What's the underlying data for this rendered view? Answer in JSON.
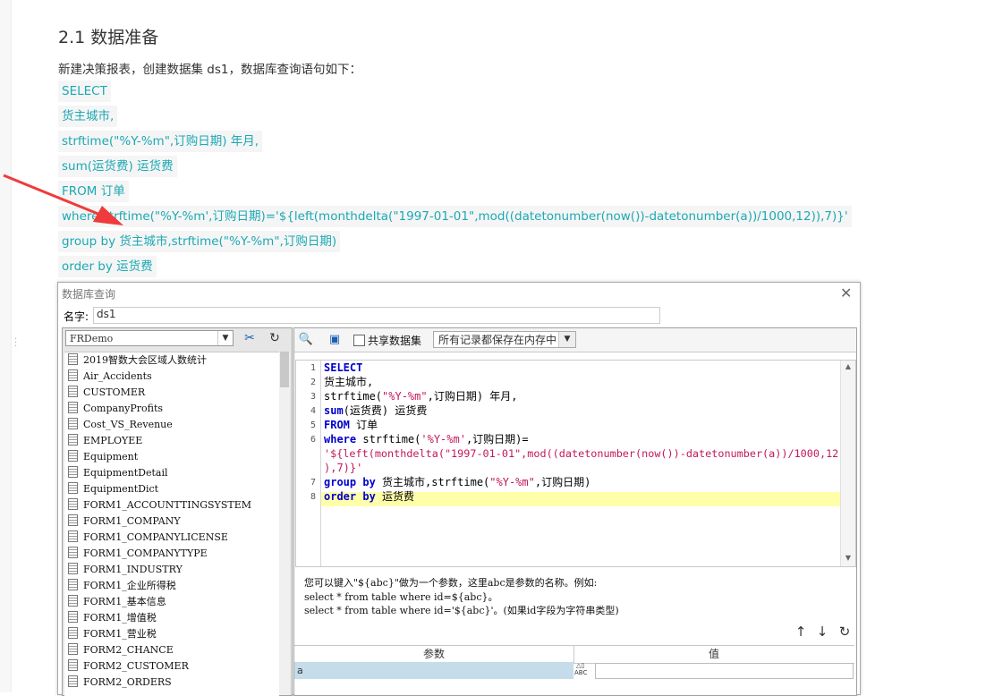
{
  "article": {
    "title": "2.1 数据准备",
    "desc": "新建决策报表，创建数据集 ds1，数据库查询语句如下：",
    "code_lines": [
      "SELECT",
      "货主城市,",
      "strftime(\"%Y-%m\",订购日期) 年月,",
      "sum(运货费) 运货费",
      "FROM 订单",
      "where strftime(\"%Y-%m',订购日期)='${left(monthdelta(\"1997-01-01\",mod((datetonumber(now())-datetonumber(a))/1000,12)),7)}'",
      "group by 货主城市,strftime(\"%Y-%m\",订购日期)",
      "order by 运货费"
    ]
  },
  "dialog": {
    "title": "数据库查询",
    "name_label": "名字:",
    "name_value": "ds1",
    "datasource": "FRDemo",
    "share_label": "共享数据集",
    "cache_option": "所有记录都保存在内存中",
    "tables": [
      "2019智数大会区域人数统计",
      "Air_Accidents",
      "CUSTOMER",
      "CompanyProfits",
      "Cost_VS_Revenue",
      "EMPLOYEE",
      "Equipment",
      "EquipmentDetail",
      "EquipmentDict",
      "FORM1_ACCOUNTTINGSYSTEM",
      "FORM1_COMPANY",
      "FORM1_COMPANYLICENSE",
      "FORM1_COMPANYTYPE",
      "FORM1_INDUSTRY",
      "FORM1_企业所得税",
      "FORM1_基本信息",
      "FORM1_增值税",
      "FORM1_营业税",
      "FORM2_CHANCE",
      "FORM2_CUSTOMER",
      "FORM2_ORDERS"
    ],
    "sql": {
      "line_numbers": [
        "1",
        "2",
        "3",
        "4",
        "5",
        "6",
        "7",
        "8"
      ],
      "l1_kw": "SELECT",
      "l2": "货主城市,",
      "l3_a": "strftime(",
      "l3_str": "\"%Y-%m\"",
      "l3_b": ",订购日期) 年月,",
      "l4_kw": "sum",
      "l4_b": "(运货费) 运货费",
      "l5_kw": "FROM",
      "l5_b": " 订单",
      "l6_kw": "where",
      "l6_a": " strftime(",
      "l6_str": "'%Y-%m'",
      "l6_b": ",订购日期)=",
      "l6_wrap1": "'${left(monthdelta(\"1997-01-01\",mod((datetonumber(now())-datetonumber(a))/1000,12)",
      "l6_wrap2": "),7)}'",
      "l7_kw": "group by",
      "l7_a": " 货主城市,strftime(",
      "l7_str": "\"%Y-%m\"",
      "l7_b": ",订购日期)",
      "l8_kw": "order by",
      "l8_b": " 运货费"
    },
    "hint_lines": [
      "您可以键入\"${abc}\"做为一个参数，这里abc是参数的名称。例如:",
      "select * from table where id=${abc}。",
      "select * from table where id='${abc}'。(如果id字段为字符串类型)"
    ],
    "param_header": {
      "name": "参数",
      "value": "值"
    },
    "params": [
      {
        "name": "a",
        "type_label": "ABC"
      }
    ]
  }
}
